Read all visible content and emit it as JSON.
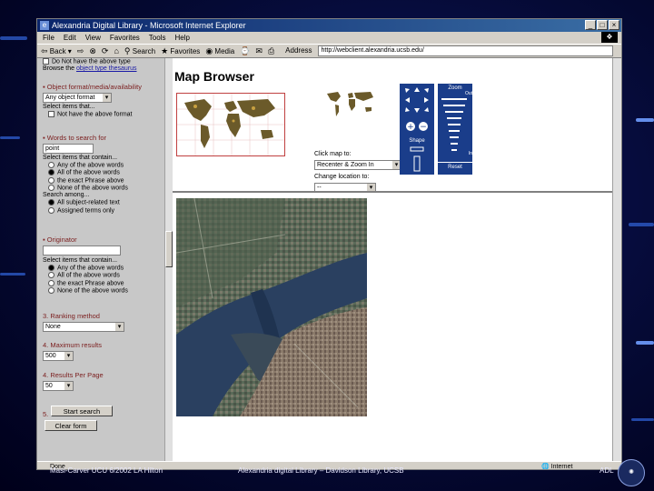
{
  "window": {
    "title": "Alexandria Digital Library - Microsoft Internet Explorer",
    "menu": [
      "File",
      "Edit",
      "View",
      "Favorites",
      "Tools",
      "Help"
    ],
    "toolbar": {
      "back": "Back",
      "search": "Search",
      "favorites": "Favorites",
      "media": "Media"
    },
    "address_label": "Address",
    "address_value": "http://webclient.alexandria.ucsb.edu/"
  },
  "left_frame": {
    "top_text": "Do Not have the above type",
    "browse_prefix": "Browse the ",
    "browse_link": "object type thesaurus",
    "object_head": "Object format/media/availability",
    "object_select": "Any object format",
    "select_items_that": "Select items that...",
    "not_have_format": "Not have the above format",
    "words_head": "Words to search for",
    "words_value": "point",
    "select_items_contain": "Select items that contain...",
    "word_opts": [
      "Any of the above words",
      "All of the above words",
      "the exact Phrase above",
      "None of the above words"
    ],
    "search_among": "Search among...",
    "among_opts": [
      "All subject-related text",
      "Assigned terms only"
    ],
    "originator_head": "Originator",
    "originator_value": "",
    "orig_opts": [
      "Any of the above words",
      "All of the above words",
      "the exact Phrase above",
      "None of the above words"
    ],
    "ranking_head": "3. Ranking method",
    "ranking_value": "None",
    "max_head": "4. Maximum results",
    "max_value": "500",
    "perpage_head": "4. Results Per Page",
    "perpage_value": "50",
    "step5": "5.",
    "start_button": "Start search",
    "clear_button": "Clear form"
  },
  "map_browser": {
    "title": "Map Browser",
    "click_label": "Click map to:",
    "click_select": "Recenter & Zoom In",
    "change_label": "Change location to:",
    "change_select": "--",
    "shape_label": "Shape",
    "zoom_label": "Zoom",
    "zoom_top": "Out",
    "zoom_bottom": "In",
    "reset_label": "Reset"
  },
  "status": {
    "left": "Done",
    "right": "Internet"
  },
  "footer": {
    "left": "Masi-Carver UCU 6/2002 LA Hilton",
    "center": "Alexandria digital Library – Davidson Library, UCSB",
    "right": "ADL"
  },
  "colors": {
    "slide_bg": "#050a35",
    "panel_blue": "#1a3d8a",
    "section_head": "#7b1e1e"
  }
}
